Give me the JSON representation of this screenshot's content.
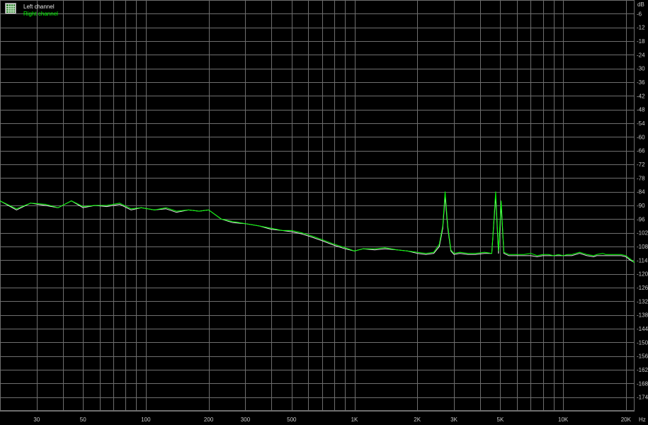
{
  "colors": {
    "background": "#000000",
    "grid": "#6e6e6e",
    "tick_text": "#c8c8c8",
    "left_channel": "#e6e6e6",
    "right_channel": "#00ff00"
  },
  "legend": {
    "icon": "table-grid-icon",
    "left_label": "Left channel",
    "right_label": "Right channel"
  },
  "chart_data": {
    "type": "line",
    "x_unit": "Hz",
    "y_unit": "dB",
    "xscale": "log",
    "xlim": [
      20,
      22000
    ],
    "ylim": [
      -180,
      0
    ],
    "grid": true,
    "legend_position": "top-left",
    "x_tick_labels": [
      "30",
      "50",
      "100",
      "200",
      "300",
      "500",
      "1K",
      "2K",
      "3K",
      "5K",
      "10K",
      "20K"
    ],
    "x_tick_values": [
      30,
      50,
      100,
      200,
      300,
      500,
      1000,
      2000,
      3000,
      5000,
      10000,
      20000
    ],
    "y_tick_values": [
      -6,
      -12,
      -18,
      -24,
      -30,
      -36,
      -42,
      -48,
      -54,
      -60,
      -66,
      -72,
      -78,
      -84,
      -90,
      -96,
      -102,
      -108,
      -114,
      -120,
      -126,
      -132,
      -138,
      -144,
      -150,
      -156,
      -162,
      -168,
      -174
    ],
    "series": [
      {
        "name": "Left channel",
        "color": "#e6e6e6",
        "x": [
          20,
          24,
          28,
          33,
          38,
          44,
          50,
          57,
          65,
          75,
          85,
          95,
          110,
          125,
          140,
          160,
          180,
          200,
          230,
          260,
          300,
          350,
          400,
          450,
          500,
          560,
          630,
          700,
          800,
          900,
          1000,
          1100,
          1250,
          1400,
          1600,
          1800,
          2000,
          2200,
          2400,
          2550,
          2650,
          2720,
          2800,
          2900,
          3000,
          3200,
          3500,
          3800,
          4200,
          4550,
          4750,
          4900,
          5050,
          5200,
          5500,
          6000,
          6500,
          7000,
          7500,
          8000,
          8500,
          9000,
          9500,
          10000,
          10500,
          11000,
          12000,
          13000,
          14000,
          14500,
          15500,
          16000,
          17000,
          18000,
          19000,
          20000,
          21000,
          22000
        ],
        "y": [
          -88,
          -92,
          -89,
          -90,
          -91,
          -88,
          -91,
          -90,
          -90.5,
          -89.5,
          -92,
          -91,
          -92,
          -91.5,
          -93,
          -92,
          -92.5,
          -92,
          -96,
          -97.5,
          -98,
          -99,
          -100.5,
          -101,
          -101.5,
          -102.5,
          -104,
          -105.5,
          -107.5,
          -109,
          -110,
          -109,
          -109.5,
          -109,
          -109.5,
          -110,
          -111,
          -111.5,
          -111,
          -108,
          -100,
          -86,
          -100,
          -110,
          -111.5,
          -111,
          -111.5,
          -111.5,
          -111,
          -111,
          -86,
          -111,
          -90,
          -111,
          -112,
          -112,
          -112,
          -112,
          -112.5,
          -112,
          -112,
          -112,
          -112,
          -112,
          -112,
          -112,
          -111,
          -112,
          -112.5,
          -112,
          -112,
          -112,
          -112,
          -112,
          -112,
          -112.5,
          -114,
          -115
        ]
      },
      {
        "name": "Right channel",
        "color": "#00ff00",
        "x": [
          20,
          24,
          28,
          33,
          38,
          44,
          50,
          57,
          65,
          75,
          85,
          95,
          110,
          125,
          140,
          160,
          180,
          200,
          230,
          260,
          300,
          350,
          400,
          450,
          500,
          560,
          630,
          700,
          800,
          900,
          1000,
          1100,
          1250,
          1400,
          1600,
          1800,
          2000,
          2200,
          2400,
          2550,
          2650,
          2720,
          2800,
          2900,
          3000,
          3200,
          3500,
          3800,
          4200,
          4550,
          4750,
          4900,
          5050,
          5200,
          5500,
          6000,
          6500,
          7000,
          7500,
          8000,
          8500,
          9000,
          9500,
          10000,
          10500,
          11000,
          12000,
          13000,
          14000,
          14500,
          15500,
          16000,
          17000,
          18000,
          19000,
          20000,
          21000,
          22000
        ],
        "y": [
          -88,
          -91.5,
          -89,
          -89.5,
          -91,
          -88,
          -90.5,
          -90,
          -90,
          -89,
          -91.5,
          -91,
          -92,
          -91,
          -92.5,
          -92,
          -92.5,
          -92,
          -96,
          -97,
          -98,
          -99,
          -100,
          -101,
          -101,
          -102,
          -103.5,
          -105,
          -107,
          -108.5,
          -110,
          -109,
          -109,
          -108.5,
          -109.5,
          -110,
          -110.5,
          -111,
          -110.5,
          -107,
          -99,
          -84,
          -99,
          -109.5,
          -111,
          -110.5,
          -111,
          -111,
          -110.5,
          -111,
          -84,
          -110,
          -88,
          -110.5,
          -111.5,
          -111.5,
          -111.5,
          -111,
          -112,
          -111.5,
          -111.5,
          -112,
          -111.5,
          -112,
          -111.5,
          -111.5,
          -110.5,
          -111.5,
          -112,
          -111.5,
          -111,
          -111.5,
          -111.5,
          -111.5,
          -111.5,
          -112,
          -113.5,
          -115
        ]
      }
    ]
  }
}
